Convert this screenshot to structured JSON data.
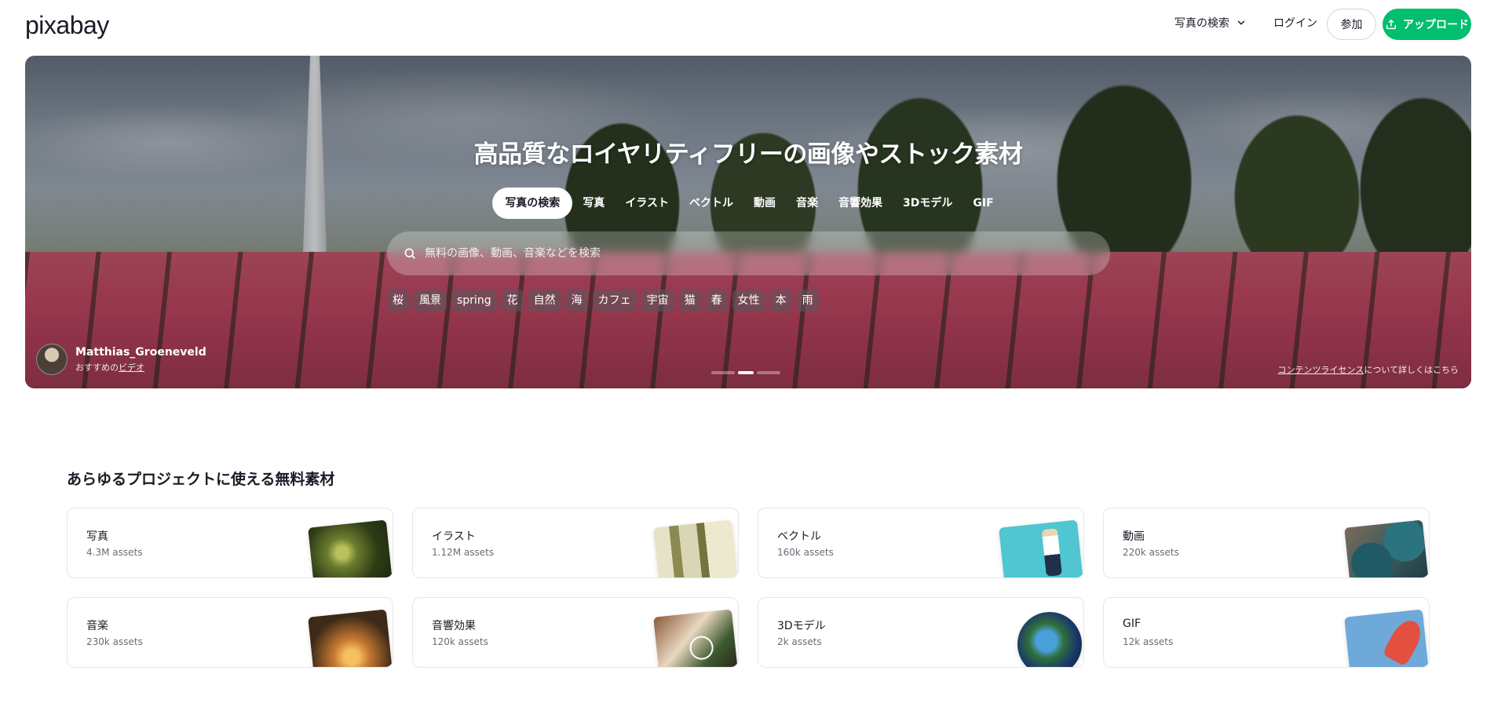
{
  "header": {
    "logo": "pixabay",
    "explore_label": "写真の検索",
    "login_label": "ログイン",
    "join_label": "参加",
    "upload_label": "アップロード"
  },
  "hero": {
    "title": "高品質なロイヤリティフリーの画像やストック素材",
    "tabs": [
      {
        "label": "写真の検索",
        "active": true
      },
      {
        "label": "写真",
        "active": false
      },
      {
        "label": "イラスト",
        "active": false
      },
      {
        "label": "ベクトル",
        "active": false
      },
      {
        "label": "動画",
        "active": false
      },
      {
        "label": "音楽",
        "active": false
      },
      {
        "label": "音響効果",
        "active": false
      },
      {
        "label": "3Dモデル",
        "active": false
      },
      {
        "label": "GIF",
        "active": false
      }
    ],
    "search_placeholder": "無料の画像、動画、音楽などを検索",
    "chips": [
      "桜",
      "風景",
      "spring",
      "花",
      "自然",
      "海",
      "カフェ",
      "宇宙",
      "猫",
      "春",
      "女性",
      "本",
      "雨"
    ],
    "credit": {
      "name": "Matthias_Groeneveld",
      "sub_prefix": "おすすめの",
      "sub_link": "ビデオ"
    },
    "slides": {
      "count": 3,
      "active_index": 1
    },
    "license": {
      "link": "コンテンツライセンス",
      "suffix": "について詳しくはこちら"
    }
  },
  "section": {
    "title": "あらゆるプロジェクトに使える無料素材",
    "cards": [
      {
        "label": "写真",
        "count": "4.3M assets",
        "thumb": "photo"
      },
      {
        "label": "イラスト",
        "count": "1.12M assets",
        "thumb": "illus"
      },
      {
        "label": "ベクトル",
        "count": "160k assets",
        "thumb": "vector"
      },
      {
        "label": "動画",
        "count": "220k assets",
        "thumb": "video"
      },
      {
        "label": "音楽",
        "count": "230k assets",
        "thumb": "music"
      },
      {
        "label": "音響効果",
        "count": "120k assets",
        "thumb": "sfx"
      },
      {
        "label": "3Dモデル",
        "count": "2k assets",
        "thumb": "3d"
      },
      {
        "label": "GIF",
        "count": "12k assets",
        "thumb": "gif"
      }
    ]
  },
  "colors": {
    "brand_green": "#02be6e",
    "text_dark": "#191b26",
    "text_muted": "#6a6c76"
  },
  "icons": {
    "explore": "chevron-down-icon",
    "upload": "upload-icon",
    "search": "search-icon"
  }
}
